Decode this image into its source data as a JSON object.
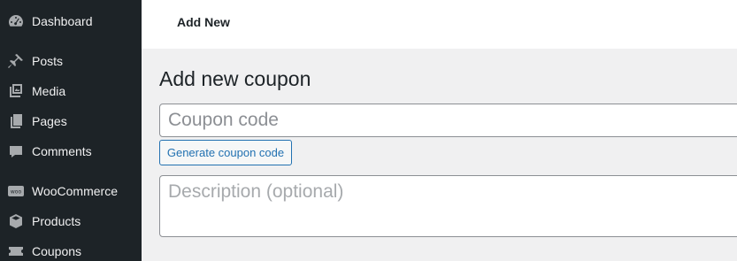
{
  "sidebar": {
    "items": [
      {
        "label": "Dashboard",
        "icon": "dashboard-icon"
      },
      {
        "label": "Posts",
        "icon": "pin-icon"
      },
      {
        "label": "Media",
        "icon": "media-icon"
      },
      {
        "label": "Pages",
        "icon": "pages-icon"
      },
      {
        "label": "Comments",
        "icon": "comments-icon"
      },
      {
        "label": "WooCommerce",
        "icon": "woocommerce-icon"
      },
      {
        "label": "Products",
        "icon": "products-icon"
      },
      {
        "label": "Coupons",
        "icon": "coupons-icon"
      }
    ]
  },
  "header": {
    "tab_label": "Add New"
  },
  "main": {
    "title": "Add new coupon",
    "coupon_code_placeholder": "Coupon code",
    "generate_button_label": "Generate coupon code",
    "description_placeholder": "Description (optional)"
  },
  "colors": {
    "sidebar_bg": "#1d2327",
    "accent": "#2271b1",
    "page_bg": "#f0f0f1"
  }
}
